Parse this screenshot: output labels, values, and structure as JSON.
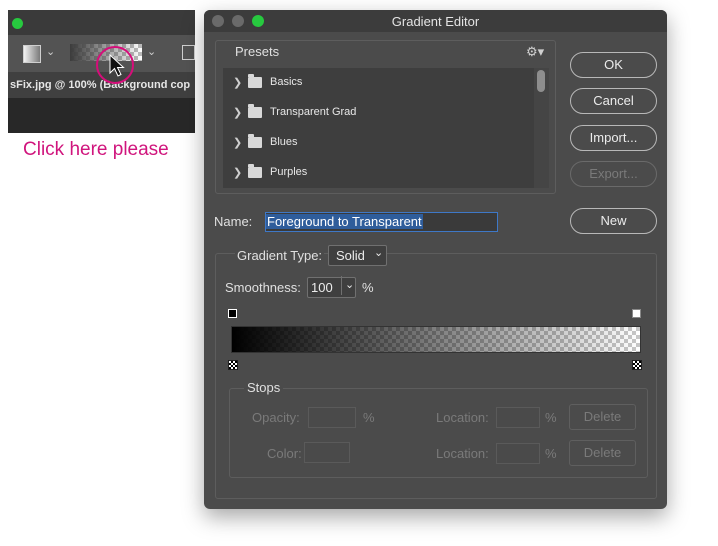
{
  "photoshop": {
    "tab_title": "sFix.jpg @ 100% (Background cop",
    "callout": "Click here please"
  },
  "dialog": {
    "title": "Gradient Editor",
    "presets": {
      "label": "Presets",
      "items": [
        {
          "label": "Basics"
        },
        {
          "label": "Transparent Grad"
        },
        {
          "label": "Blues"
        },
        {
          "label": "Purples"
        }
      ]
    },
    "buttons": {
      "ok": "OK",
      "cancel": "Cancel",
      "import": "Import...",
      "export": "Export...",
      "new": "New"
    },
    "name": {
      "label": "Name:",
      "value": "Foreground to Transparent"
    },
    "gradient_type": {
      "label": "Gradient Type:",
      "value": "Solid"
    },
    "smoothness": {
      "label": "Smoothness:",
      "value": "100",
      "unit": "%"
    },
    "stops": {
      "label": "Stops",
      "opacity_label": "Opacity:",
      "color_label": "Color:",
      "location_label": "Location:",
      "pct": "%",
      "delete_label": "Delete"
    }
  },
  "colors": {
    "callout": "#d0157d",
    "highlight_ring": "#d60d7a",
    "dialog_bg": "#4b4b4b",
    "selection": "#2f5d9b"
  }
}
